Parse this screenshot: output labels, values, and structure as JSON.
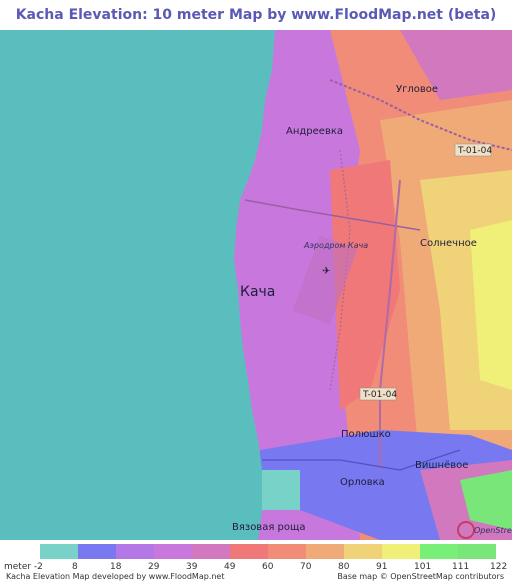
{
  "title": "Kacha Elevation: 10 meter Map by www.FloodMap.net (beta)",
  "map": {
    "places": {
      "uglovoe": "Угловое",
      "andreevka": "Андреевка",
      "road_north": "T-01-04",
      "airfield": "Аэродром Кача",
      "solnechnoe": "Солнечное",
      "kacha": "Кача",
      "road_south": "T-01-04",
      "polyushko": "Полюшко",
      "vishnevoe": "Вишнёвое",
      "orlovka": "Орловка",
      "vyazovaya": "Вязовая роща"
    },
    "watermark": "OpenStreetMap"
  },
  "legend": {
    "unit_label": "meter",
    "values": [
      "-2",
      "8",
      "18",
      "29",
      "39",
      "49",
      "60",
      "70",
      "80",
      "91",
      "101",
      "111",
      "122"
    ],
    "colors": [
      "#78d2c8",
      "#7878f0",
      "#b478e6",
      "#c878dc",
      "#d278be",
      "#f07878",
      "#f08c78",
      "#f0aa78",
      "#f0d278",
      "#f0f078",
      "#78f078",
      "#78e678"
    ]
  },
  "footer": {
    "left": "Kacha Elevation Map developed by www.FloodMap.net",
    "right": "Base map © OpenStreetMap contributors"
  }
}
